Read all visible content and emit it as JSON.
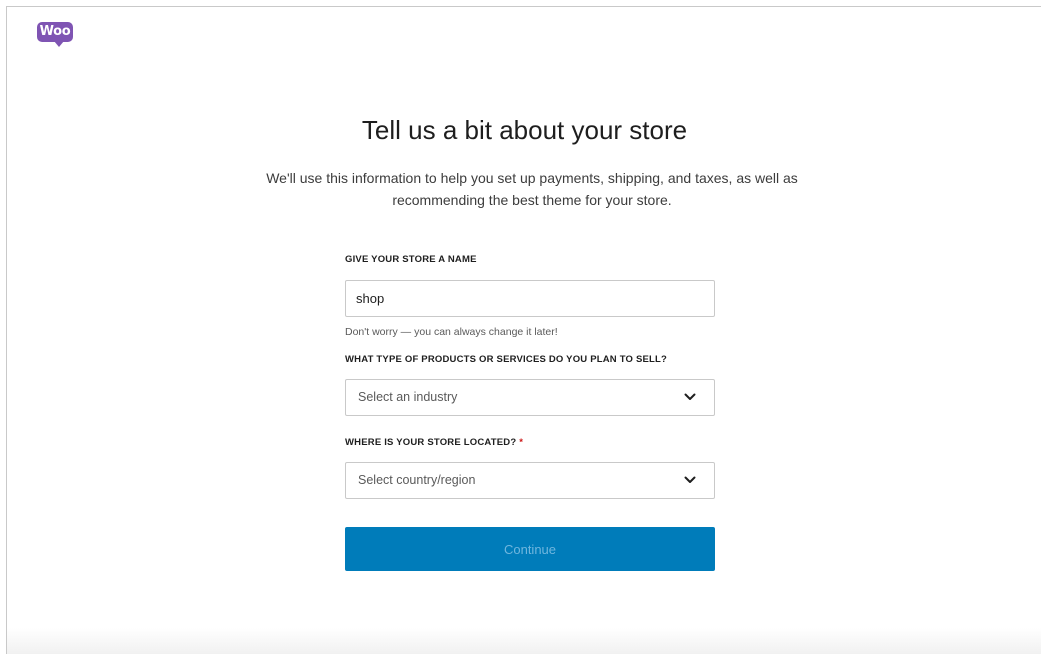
{
  "brand": {
    "logo_text": "Woo",
    "color": "#7f54b3"
  },
  "header": {
    "title": "Tell us a bit about your store",
    "subtitle": "We'll use this information to help you set up payments, shipping, and taxes, as well as recommending the best theme for your store."
  },
  "form": {
    "store_name": {
      "label": "GIVE YOUR STORE A NAME",
      "value": "shop",
      "help": "Don't worry — you can always change it later!"
    },
    "industry": {
      "label": "WHAT TYPE OF PRODUCTS OR SERVICES DO YOU PLAN TO SELL?",
      "placeholder": "Select an industry",
      "icon": "chevron-down-icon"
    },
    "location": {
      "label": "WHERE IS YOUR STORE LOCATED?",
      "required_mark": "*",
      "placeholder": "Select country/region",
      "icon": "chevron-down-icon"
    },
    "continue_label": "Continue"
  },
  "colors": {
    "primary": "#007cba",
    "primary_text_disabled": "#6fb6de",
    "required": "#cc1818"
  }
}
